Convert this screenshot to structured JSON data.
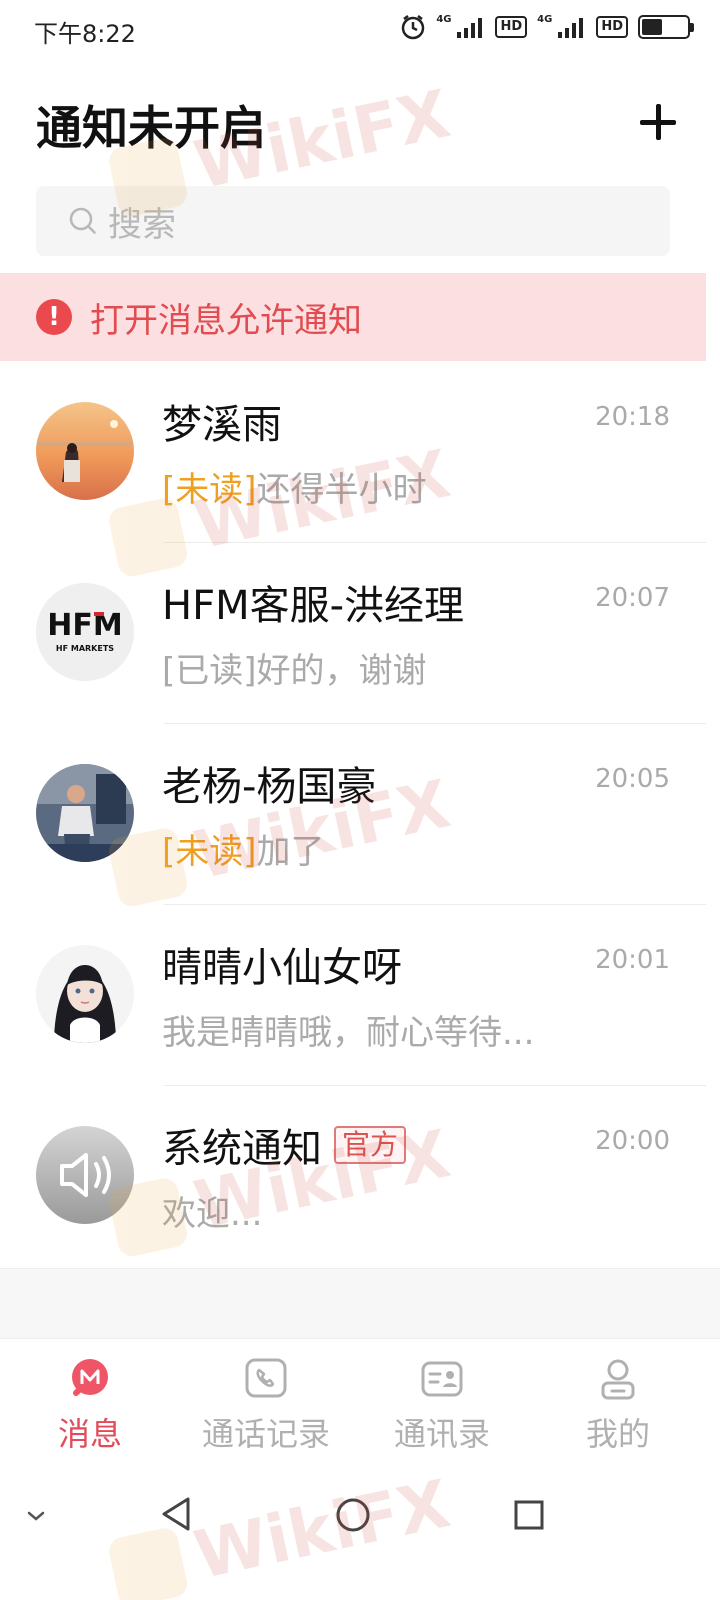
{
  "status_bar": {
    "time": "下午8:22",
    "network_1": "4G",
    "network_2": "4G",
    "hd_1": "HD",
    "hd_2": "HD",
    "battery_level": 0.45
  },
  "header": {
    "title": "通知未开启"
  },
  "search": {
    "placeholder": "搜索"
  },
  "notice": {
    "icon": "!",
    "text": "打开消息允许通知"
  },
  "conversations": [
    {
      "name": "梦溪雨",
      "time": "20:18",
      "tag": "[未读]",
      "tag_type": "unread",
      "preview": "还得半小时",
      "avatar": "photo-sunset"
    },
    {
      "name": "HFM客服-洪经理",
      "time": "20:07",
      "tag": "[已读]",
      "tag_type": "read",
      "preview": "好的，谢谢",
      "avatar": "hfm-logo",
      "avatar_text": "HFM",
      "avatar_subtext": "HF MARKETS"
    },
    {
      "name": "老杨-杨国豪",
      "time": "20:05",
      "tag": "[未读]",
      "tag_type": "unread",
      "preview": "加了",
      "avatar": "photo-man"
    },
    {
      "name": "晴晴小仙女呀",
      "time": "20:01",
      "tag": "",
      "tag_type": "none",
      "preview": "我是晴晴哦，耐心等待...",
      "avatar": "illustration-girl"
    },
    {
      "name": "系统通知",
      "badge": "官方",
      "time": "20:00",
      "tag": "",
      "tag_type": "none",
      "preview": "欢迎...",
      "avatar": "speaker-icon"
    }
  ],
  "tabs": [
    {
      "label": "消息",
      "icon": "message-icon",
      "active": true
    },
    {
      "label": "通话记录",
      "icon": "phone-icon",
      "active": false
    },
    {
      "label": "通讯录",
      "icon": "contact-card-icon",
      "active": false
    },
    {
      "label": "我的",
      "icon": "profile-icon",
      "active": false
    }
  ],
  "watermark": {
    "text": "WikiFX"
  },
  "colors": {
    "accent": "#e24b5a",
    "unread": "#f0a020",
    "notice_bg": "#fbdfe1",
    "notice_text": "#e24b4f"
  }
}
